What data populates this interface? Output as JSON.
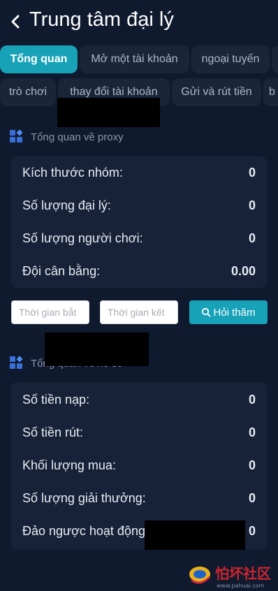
{
  "header": {
    "back_icon": "chevron-left-icon",
    "title": "Trung tâm đại lý"
  },
  "tabs_row1": [
    {
      "label": "Tổng quan",
      "active": true
    },
    {
      "label": "Mở một tài khoản",
      "active": false
    },
    {
      "label": "ngoại tuyến",
      "active": false
    },
    {
      "label": "",
      "active": false
    }
  ],
  "tabs_row2": [
    {
      "label": "trò chơi"
    },
    {
      "label": "thay đổi tài khoản"
    },
    {
      "label": "Gửi và rút tiền"
    },
    {
      "label": "b"
    }
  ],
  "proxy_overview": {
    "icon": "grid-icon",
    "title": "Tổng quan về proxy",
    "rows": [
      {
        "label": "Kích thước nhóm:",
        "value": "0"
      },
      {
        "label": "Số lượng đại lý:",
        "value": "0"
      },
      {
        "label": "Số lượng người chơi:",
        "value": "0"
      },
      {
        "label": "Đội cân bằng:",
        "value": "0.00"
      }
    ]
  },
  "filters": {
    "start_placeholder": "Thời gian bắt",
    "end_placeholder": "Thời gian kết",
    "query_label": "Hỏi thăm",
    "query_icon": "search-icon"
  },
  "lottery_overview": {
    "icon": "grid-icon",
    "title": "Tổng quan về xổ số",
    "rows": [
      {
        "label": "Số tiền nạp:",
        "value": "0"
      },
      {
        "label": "Số tiền rút:",
        "value": "0"
      },
      {
        "label": "Khối lượng mua:",
        "value": "0"
      },
      {
        "label": "Số lượng giải thưởng:",
        "value": "0"
      },
      {
        "label": "Đảo ngược hoạt động",
        "value": "0"
      }
    ]
  },
  "watermark": {
    "text": "怕坏社区",
    "url_text": "www.pahuai.com"
  },
  "colors": {
    "background": "#101a2e",
    "card": "#172238",
    "accent": "#17a2b8",
    "tab_bg": "#1a2539"
  }
}
